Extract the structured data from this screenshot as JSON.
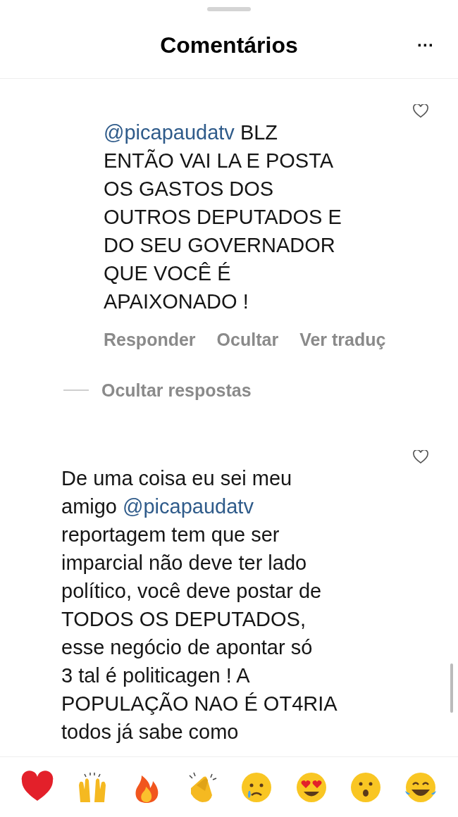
{
  "header": {
    "title": "Comentários",
    "more": "···"
  },
  "comments": [
    {
      "kind": "reply",
      "lines": [
        [
          {
            "kind": "mention",
            "text": "@picapaudatv"
          },
          {
            "kind": "text",
            "text": " BLZ"
          }
        ],
        [
          {
            "kind": "text",
            "text": "ENTÃO VAI LA E POSTA"
          }
        ],
        [
          {
            "kind": "text",
            "text": "OS GASTOS DOS"
          }
        ],
        [
          {
            "kind": "text",
            "text": "OUTROS DEPUTADOS E"
          }
        ],
        [
          {
            "kind": "text",
            "text": "DO SEU GOVERNADOR"
          }
        ],
        [
          {
            "kind": "text",
            "text": "QUE VOCÊ É"
          }
        ],
        [
          {
            "kind": "text",
            "text": "APAIXONADO !"
          }
        ]
      ],
      "actions": [
        "Responder",
        "Ocultar",
        "Ver traduç"
      ],
      "hide_replies": "Ocultar respostas",
      "liked": false
    },
    {
      "kind": "top",
      "lines": [
        [
          {
            "kind": "text",
            "text": "De uma coisa eu sei meu"
          }
        ],
        [
          {
            "kind": "text",
            "text": "amigo "
          },
          {
            "kind": "mention",
            "text": "@picapaudatv"
          }
        ],
        [
          {
            "kind": "text",
            "text": "reportagem tem que ser"
          }
        ],
        [
          {
            "kind": "text",
            "text": "imparcial não deve ter lado"
          }
        ],
        [
          {
            "kind": "text",
            "text": "político, você deve postar de"
          }
        ],
        [
          {
            "kind": "text",
            "text": "TODOS OS DEPUTADOS,"
          }
        ],
        [
          {
            "kind": "text",
            "text": "esse negócio de apontar só"
          }
        ],
        [
          {
            "kind": "text",
            "text": "3 tal é politicagen ! A"
          }
        ],
        [
          {
            "kind": "text",
            "text": "POPULAÇÃO NAO É OT4RIA"
          }
        ],
        [
          {
            "kind": "text",
            "text": "todos já sabe como"
          }
        ]
      ],
      "liked": false
    }
  ]
}
